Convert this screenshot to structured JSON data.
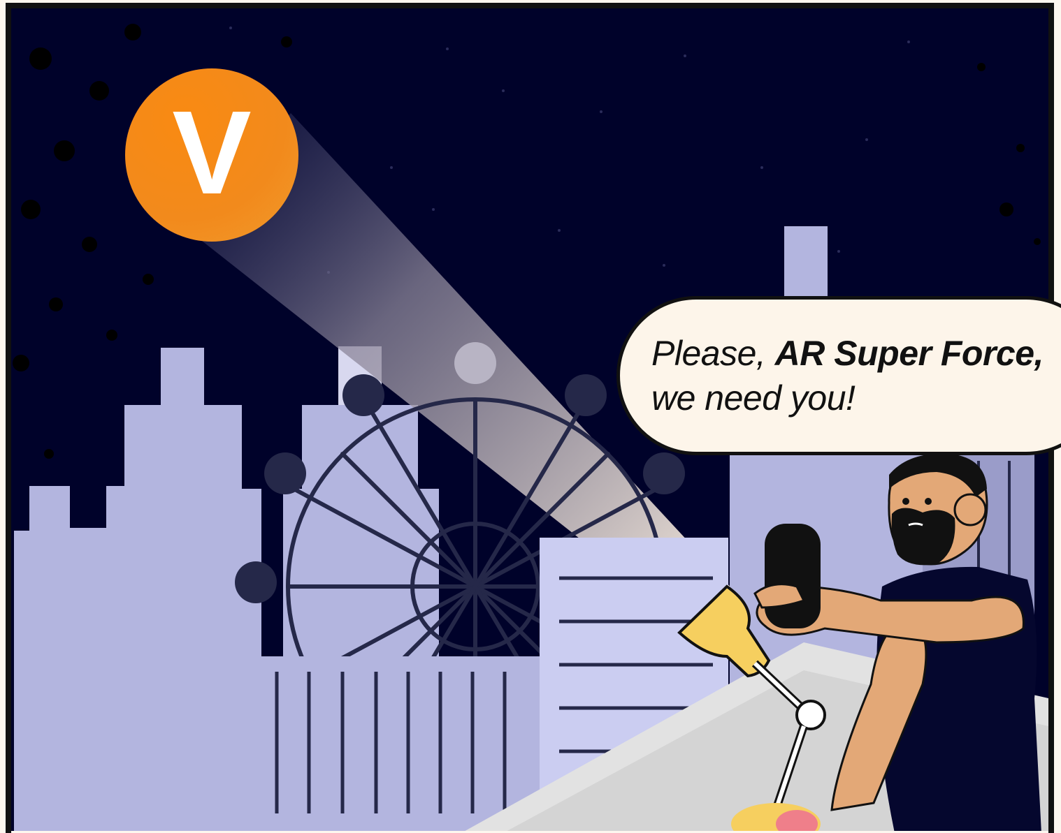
{
  "scene": {
    "badge_letter": "V",
    "speech": {
      "prefix": "Please, ",
      "emphasis": "AR Super Force",
      "suffix": ",",
      "line2": "we need you!"
    }
  },
  "colors": {
    "night_sky": "#00022a",
    "buildings": "#b3b5df",
    "buildings_light": "#cbcdf1",
    "badge_orange": "#f28a12",
    "beam": "#fdf1e2",
    "flashlight": "#f6cf5f",
    "skin": "#e3a877",
    "outline": "#111111"
  }
}
